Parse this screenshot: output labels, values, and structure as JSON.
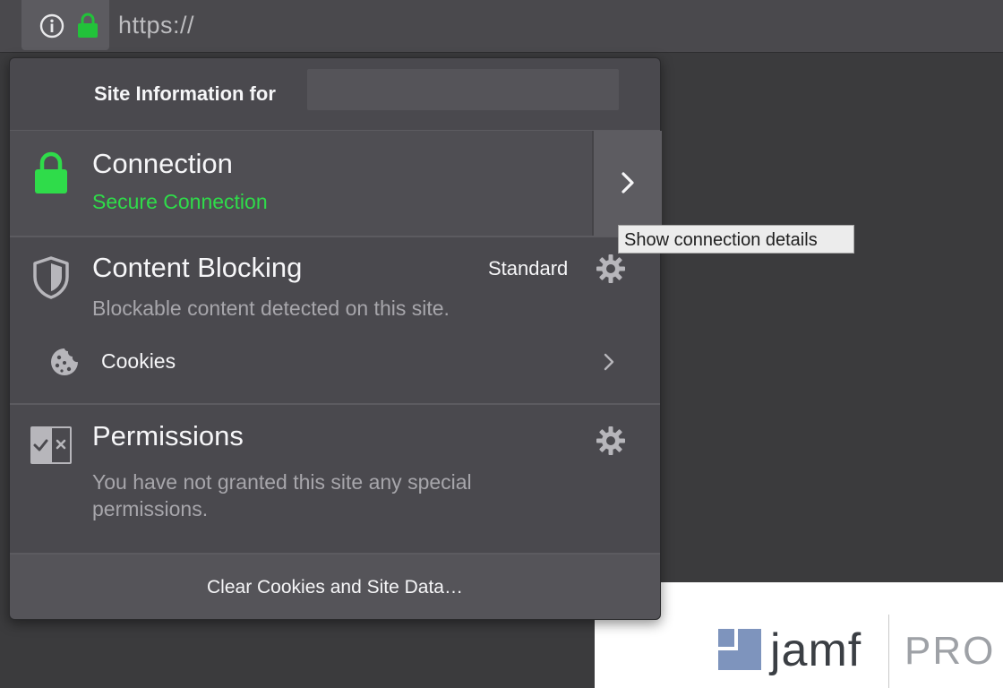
{
  "urlbar": {
    "url_text": "https://",
    "info_icon": "info-circle-icon",
    "lock_icon": "lock-icon"
  },
  "panel": {
    "header_title": "Site Information for",
    "connection": {
      "title": "Connection",
      "status": "Secure Connection",
      "more_icon": "chevron-right-icon",
      "tooltip": "Show connection details"
    },
    "content_blocking": {
      "title": "Content Blocking",
      "level": "Standard",
      "description": "Blockable content detected on this site.",
      "cookies_label": "Cookies"
    },
    "permissions": {
      "title": "Permissions",
      "description": "You have not granted this site any special permissions."
    },
    "footer_button": "Clear Cookies and Site Data…"
  },
  "page": {
    "brand_word": "jamf",
    "brand_product": "PRO"
  },
  "colors": {
    "secure_green": "#2fdc4a",
    "panel_bg": "#4a494e",
    "brand_blue": "#7e94bd"
  }
}
